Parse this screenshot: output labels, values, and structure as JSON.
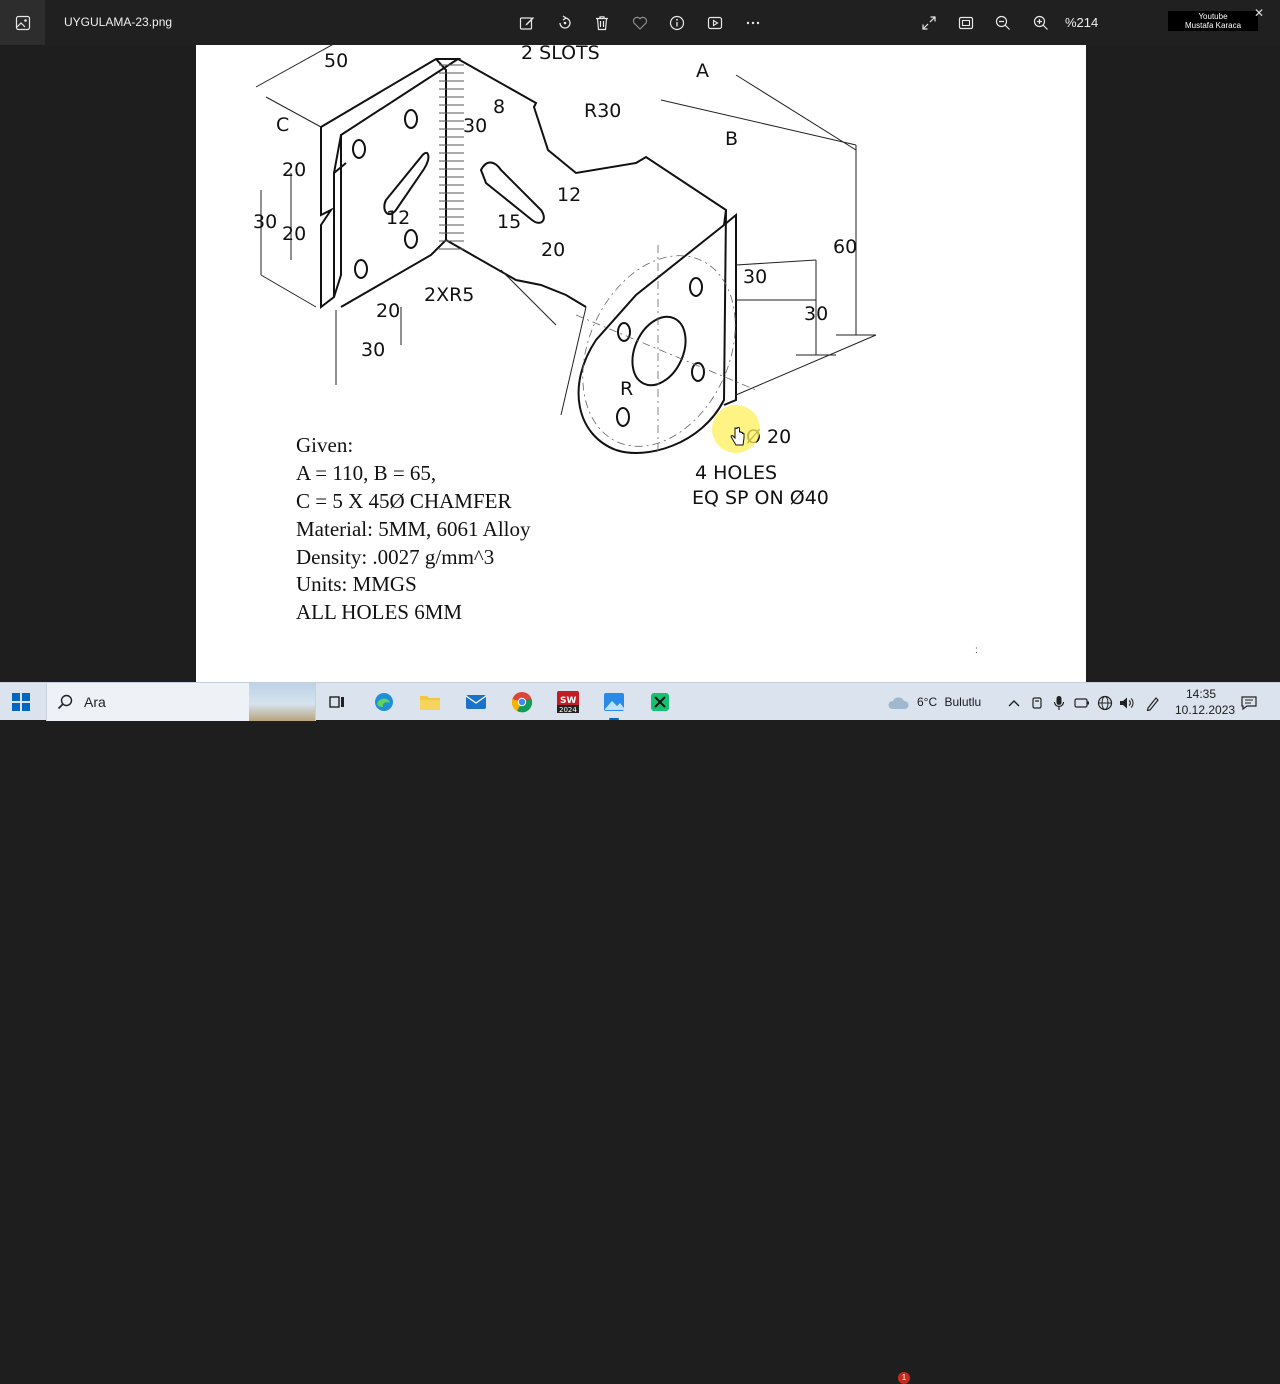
{
  "toolbar": {
    "filename": "UYGULAMA-23.png",
    "zoom": "%214",
    "watermark_line1": "Youtube",
    "watermark_line2": "Mustafa Karaca",
    "icons": [
      "photos-app-icon",
      "edit-image-icon",
      "rotate-icon",
      "delete-icon",
      "favorite-icon",
      "info-icon",
      "slideshow-icon",
      "more-icon",
      "fullscreen-icon",
      "fit-window-icon",
      "zoom-out-icon",
      "zoom-in-icon"
    ]
  },
  "drawing": {
    "labels": {
      "d50": "50",
      "slots": "2 SLOTS",
      "a": "A",
      "d8": "8",
      "r30": "R30",
      "c": "C",
      "d30a": "30",
      "b": "B",
      "d20a": "20",
      "d12a": "12",
      "d30b": "30",
      "d20b": "20",
      "d12b": "12",
      "d15": "15",
      "d20c": "20",
      "d30c": "30",
      "d60": "60",
      "d2xr5": "2XR5",
      "d30d": "30",
      "d20d": "20",
      "d30e": "30",
      "r": "R",
      "dia20": "Ø 20",
      "holes": "4 HOLES",
      "eqsp": "EQ SP ON Ø40"
    }
  },
  "notes": {
    "given": "Given:",
    "ab": "A = 110, B = 65,",
    "chamfer": "C = 5 X 45Ø CHAMFER",
    "material": "Material: 5MM, 6061 Alloy",
    "density": "Density: .0027 g/mm^3",
    "units": "Units: MMGS",
    "holes": "ALL HOLES 6MM"
  },
  "taskbar": {
    "search_placeholder": "Ara",
    "weather_temp": "6°C",
    "weather_text": "Bulutlu",
    "weather_badge": "1",
    "time": "14:35",
    "date": "10.12.2023",
    "apps": [
      "task-view",
      "edge",
      "file-explorer",
      "mail",
      "chrome",
      "solidworks",
      "photos",
      "snip-tool"
    ]
  },
  "colors": {
    "accent": "#0067c0",
    "highlight": "#fff05a"
  }
}
